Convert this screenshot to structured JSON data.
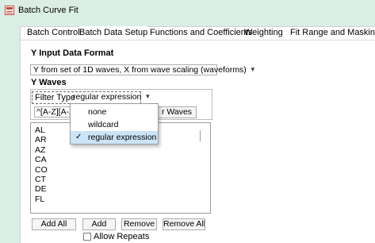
{
  "window": {
    "title": "Batch Curve Fit"
  },
  "tabs": [
    {
      "label": "Batch Control"
    },
    {
      "label": "Batch Data Setup"
    },
    {
      "label": "Functions and Coefficients"
    },
    {
      "label": "Weighting"
    },
    {
      "label": "Fit Range and Masking"
    }
  ],
  "active_tab": "Batch Data Setup",
  "y_input": {
    "heading": "Y Input Data Format",
    "format_value": "Y from set of 1D waves, X from wave scaling (waveforms)"
  },
  "y_waves": {
    "heading": "Y Waves",
    "filter_label": "Filter Type",
    "filter_value": "regular expression",
    "pattern_value": "^[A-Z][A-Z",
    "filter_button_label": "r Waves",
    "list_items": [
      "AL",
      "AR",
      "AZ",
      "CA",
      "CO",
      "CT",
      "DE",
      "FL"
    ],
    "buttons": {
      "add_all": "Add All",
      "add": "Add",
      "remove": "Remove",
      "remove_all": "Remove All"
    },
    "allow_repeats_label": "Allow Repeats",
    "allow_repeats_checked": false
  },
  "dropdown": {
    "options": [
      "none",
      "wildcard",
      "regular expression"
    ],
    "selected": "regular expression"
  },
  "colors": {
    "background": "#dbeee5",
    "selection": "#cce4f7",
    "icon": "#c2483a"
  }
}
